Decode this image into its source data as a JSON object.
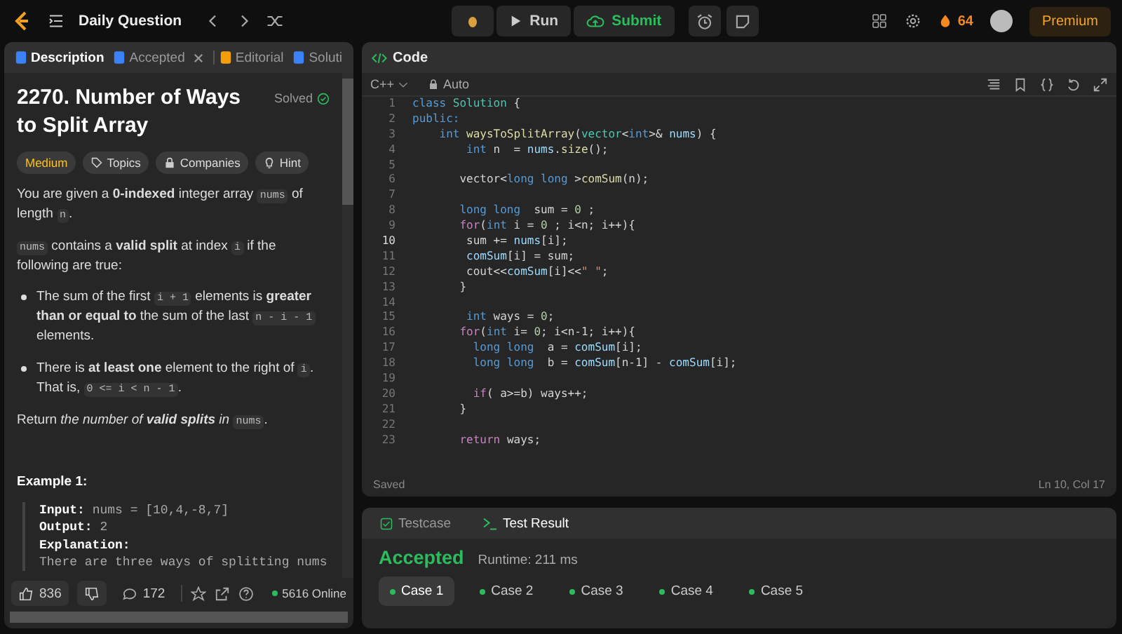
{
  "topbar": {
    "title": "Daily Question",
    "run": "Run",
    "submit": "Submit",
    "streak": "64",
    "premium": "Premium"
  },
  "left_tabs": [
    {
      "label": "Description",
      "kind": "description",
      "selected": true,
      "closable": false
    },
    {
      "label": "Accepted",
      "kind": "accepted",
      "selected": false,
      "closable": true
    },
    {
      "label": "Editorial",
      "kind": "editorial",
      "selected": false,
      "closable": false
    },
    {
      "label": "Soluti",
      "kind": "solutions",
      "selected": false,
      "closable": false
    }
  ],
  "problem": {
    "title": "2270. Number of Ways to Split Array",
    "status": "Solved",
    "difficulty": "Medium",
    "tags": [
      {
        "label": "Topics",
        "kind": "tag"
      },
      {
        "label": "Companies",
        "kind": "lock"
      },
      {
        "label": "Hint",
        "kind": "bulb"
      }
    ],
    "paragraphs": [
      {
        "kind": "p",
        "parts": [
          {
            "kind": "text",
            "text": "You are given a **0-indexed** integer array "
          },
          {
            "kind": "code",
            "text": "nums"
          },
          {
            "kind": "text",
            "text": " of length "
          },
          {
            "kind": "code",
            "text": "n"
          },
          {
            "kind": "text",
            "text": "."
          }
        ]
      },
      {
        "kind": "p",
        "parts": [
          {
            "kind": "code",
            "text": "nums"
          },
          {
            "kind": "text",
            "text": " contains a **valid split** at index "
          },
          {
            "kind": "code",
            "text": "i"
          },
          {
            "kind": "text",
            "text": " if the following are true:"
          }
        ]
      },
      {
        "kind": "li",
        "parts": [
          {
            "kind": "text",
            "text": "The sum of the first "
          },
          {
            "kind": "code",
            "text": "i + 1"
          },
          {
            "kind": "text",
            "text": " elements is **greater than or equal to** the sum of the last "
          },
          {
            "kind": "code",
            "text": "n - i - 1"
          },
          {
            "kind": "text",
            "text": " elements."
          }
        ]
      },
      {
        "kind": "li",
        "parts": [
          {
            "kind": "text",
            "text": "There is **at least one** element to the right of "
          },
          {
            "kind": "code",
            "text": "i"
          },
          {
            "kind": "text",
            "text": ". That is, "
          },
          {
            "kind": "code",
            "text": "0 <= i < n - 1"
          },
          {
            "kind": "text",
            "text": "."
          }
        ]
      },
      {
        "kind": "p",
        "parts": [
          {
            "kind": "text",
            "text": "Return "
          },
          {
            "kind": "em",
            "text": "the number of **valid splits** in "
          },
          {
            "kind": "code",
            "text": "nums"
          },
          {
            "kind": "text",
            "text": "."
          }
        ]
      }
    ],
    "example_title": "Example 1:",
    "example_lines": [
      {
        "label": "Input:",
        "text": "nums = [10,4,-8,7]"
      },
      {
        "label": "Output:",
        "text": "2"
      },
      {
        "label": "Explanation:"
      },
      {
        "text": "There are three ways of splitting nums"
      }
    ]
  },
  "footer": {
    "likes": "836",
    "comments": "172",
    "online": "5616 Online"
  },
  "code_panel": {
    "title": "Code",
    "language": "C++",
    "mode": "Auto",
    "status": "Saved",
    "cursor": "Ln 10, Col 17",
    "lines": [
      {
        "n": "1",
        "current": false,
        "tokens": [
          {
            "kind": "kw",
            "text": "class"
          },
          {
            "kind": "ty",
            "text": " Solution"
          },
          {
            "kind": "p",
            "text": " {"
          }
        ]
      },
      {
        "n": "2",
        "current": false,
        "tokens": [
          {
            "kind": "kw",
            "text": "public:"
          }
        ]
      },
      {
        "n": "3",
        "current": false,
        "tokens": [
          {
            "kind": "kw",
            "text": "    int"
          },
          {
            "kind": "fn",
            "text": " waysToSplitArray"
          },
          {
            "kind": "p",
            "text": "("
          },
          {
            "kind": "ty",
            "text": "vector"
          },
          {
            "kind": "p",
            "text": "<"
          },
          {
            "kind": "kw",
            "text": "int"
          },
          {
            "kind": "p",
            "text": ">&"
          },
          {
            "kind": "var",
            "text": " nums"
          },
          {
            "kind": "p",
            "text": ") {"
          }
        ]
      },
      {
        "n": "4",
        "current": false,
        "tokens": [
          {
            "kind": "kw",
            "text": "        int"
          },
          {
            "kind": "p",
            "text": " n  ="
          },
          {
            "kind": "var",
            "text": " nums"
          },
          {
            "kind": "p",
            "text": "."
          },
          {
            "kind": "fn",
            "text": "size"
          },
          {
            "kind": "p",
            "text": "();"
          }
        ]
      },
      {
        "n": "5",
        "current": false
      },
      {
        "n": "6",
        "current": false,
        "tokens": [
          {
            "kind": "p",
            "text": "       vector<"
          },
          {
            "kind": "kw",
            "text": "long long"
          },
          {
            "kind": "p",
            "text": " >"
          },
          {
            "kind": "fn",
            "text": "comSum"
          },
          {
            "kind": "p",
            "text": "(n);"
          }
        ]
      },
      {
        "n": "7",
        "current": false
      },
      {
        "n": "8",
        "current": false,
        "tokens": [
          {
            "kind": "kw",
            "text": "       long long"
          },
          {
            "kind": "p",
            "text": "  sum ="
          },
          {
            "kind": "num",
            "text": " 0"
          },
          {
            "kind": "p",
            "text": " ;"
          }
        ]
      },
      {
        "n": "9",
        "current": false,
        "tokens": [
          {
            "kind": "ctl",
            "text": "       for"
          },
          {
            "kind": "p",
            "text": "("
          },
          {
            "kind": "kw",
            "text": "int"
          },
          {
            "kind": "p",
            "text": " i ="
          },
          {
            "kind": "num",
            "text": " 0"
          },
          {
            "kind": "p",
            "text": " ; i<n; i++){"
          }
        ]
      },
      {
        "n": "10",
        "current": true,
        "tokens": [
          {
            "kind": "p",
            "text": "        sum +="
          },
          {
            "kind": "var",
            "text": " nums"
          },
          {
            "kind": "p",
            "text": "[i];"
          }
        ]
      },
      {
        "n": "11",
        "current": false,
        "tokens": [
          {
            "kind": "var",
            "text": "        comSum"
          },
          {
            "kind": "p",
            "text": "[i] = sum;"
          }
        ]
      },
      {
        "n": "12",
        "current": false,
        "tokens": [
          {
            "kind": "p",
            "text": "        cout<<"
          },
          {
            "kind": "var",
            "text": "comSum"
          },
          {
            "kind": "p",
            "text": "[i]<<"
          },
          {
            "kind": "str",
            "text": "\" \""
          },
          {
            "kind": "p",
            "text": ";"
          }
        ]
      },
      {
        "n": "13",
        "current": false,
        "tokens": [
          {
            "kind": "p",
            "text": "       }"
          }
        ]
      },
      {
        "n": "14",
        "current": false
      },
      {
        "n": "15",
        "current": false,
        "tokens": [
          {
            "kind": "kw",
            "text": "        int"
          },
          {
            "kind": "p",
            "text": " ways ="
          },
          {
            "kind": "num",
            "text": " 0"
          },
          {
            "kind": "p",
            "text": ";"
          }
        ]
      },
      {
        "n": "16",
        "current": false,
        "tokens": [
          {
            "kind": "ctl",
            "text": "       for"
          },
          {
            "kind": "p",
            "text": "("
          },
          {
            "kind": "kw",
            "text": "int"
          },
          {
            "kind": "p",
            "text": " i="
          },
          {
            "kind": "num",
            "text": " 0"
          },
          {
            "kind": "p",
            "text": "; i<n-1; i++){"
          }
        ]
      },
      {
        "n": "17",
        "current": false,
        "tokens": [
          {
            "kind": "kw",
            "text": "         long long"
          },
          {
            "kind": "p",
            "text": "  a ="
          },
          {
            "kind": "var",
            "text": " comSum"
          },
          {
            "kind": "p",
            "text": "[i];"
          }
        ]
      },
      {
        "n": "18",
        "current": false,
        "tokens": [
          {
            "kind": "kw",
            "text": "         long long"
          },
          {
            "kind": "p",
            "text": "  b ="
          },
          {
            "kind": "var",
            "text": " comSum"
          },
          {
            "kind": "p",
            "text": "[n-1] -"
          },
          {
            "kind": "var",
            "text": " comSum"
          },
          {
            "kind": "p",
            "text": "[i];"
          }
        ]
      },
      {
        "n": "19",
        "current": false
      },
      {
        "n": "20",
        "current": false,
        "tokens": [
          {
            "kind": "ctl",
            "text": "         if"
          },
          {
            "kind": "p",
            "text": "( a>=b) ways++;"
          }
        ]
      },
      {
        "n": "21",
        "current": false,
        "tokens": [
          {
            "kind": "p",
            "text": "       }"
          }
        ]
      },
      {
        "n": "22",
        "current": false
      },
      {
        "n": "23",
        "current": false,
        "tokens": [
          {
            "kind": "ctl",
            "text": "       return"
          },
          {
            "kind": "p",
            "text": " ways;"
          }
        ]
      }
    ]
  },
  "result_panel": {
    "tabs": [
      {
        "label": "Testcase",
        "kind": "testcase",
        "selected": false
      },
      {
        "label": "Test Result",
        "kind": "result",
        "selected": true
      }
    ],
    "verdict": "Accepted",
    "runtime": "Runtime: 211 ms",
    "cases": [
      {
        "label": "Case 1",
        "selected": true
      },
      {
        "label": "Case 2",
        "selected": false
      },
      {
        "label": "Case 3",
        "selected": false
      },
      {
        "label": "Case 4",
        "selected": false
      },
      {
        "label": "Case 5",
        "selected": false
      }
    ]
  }
}
